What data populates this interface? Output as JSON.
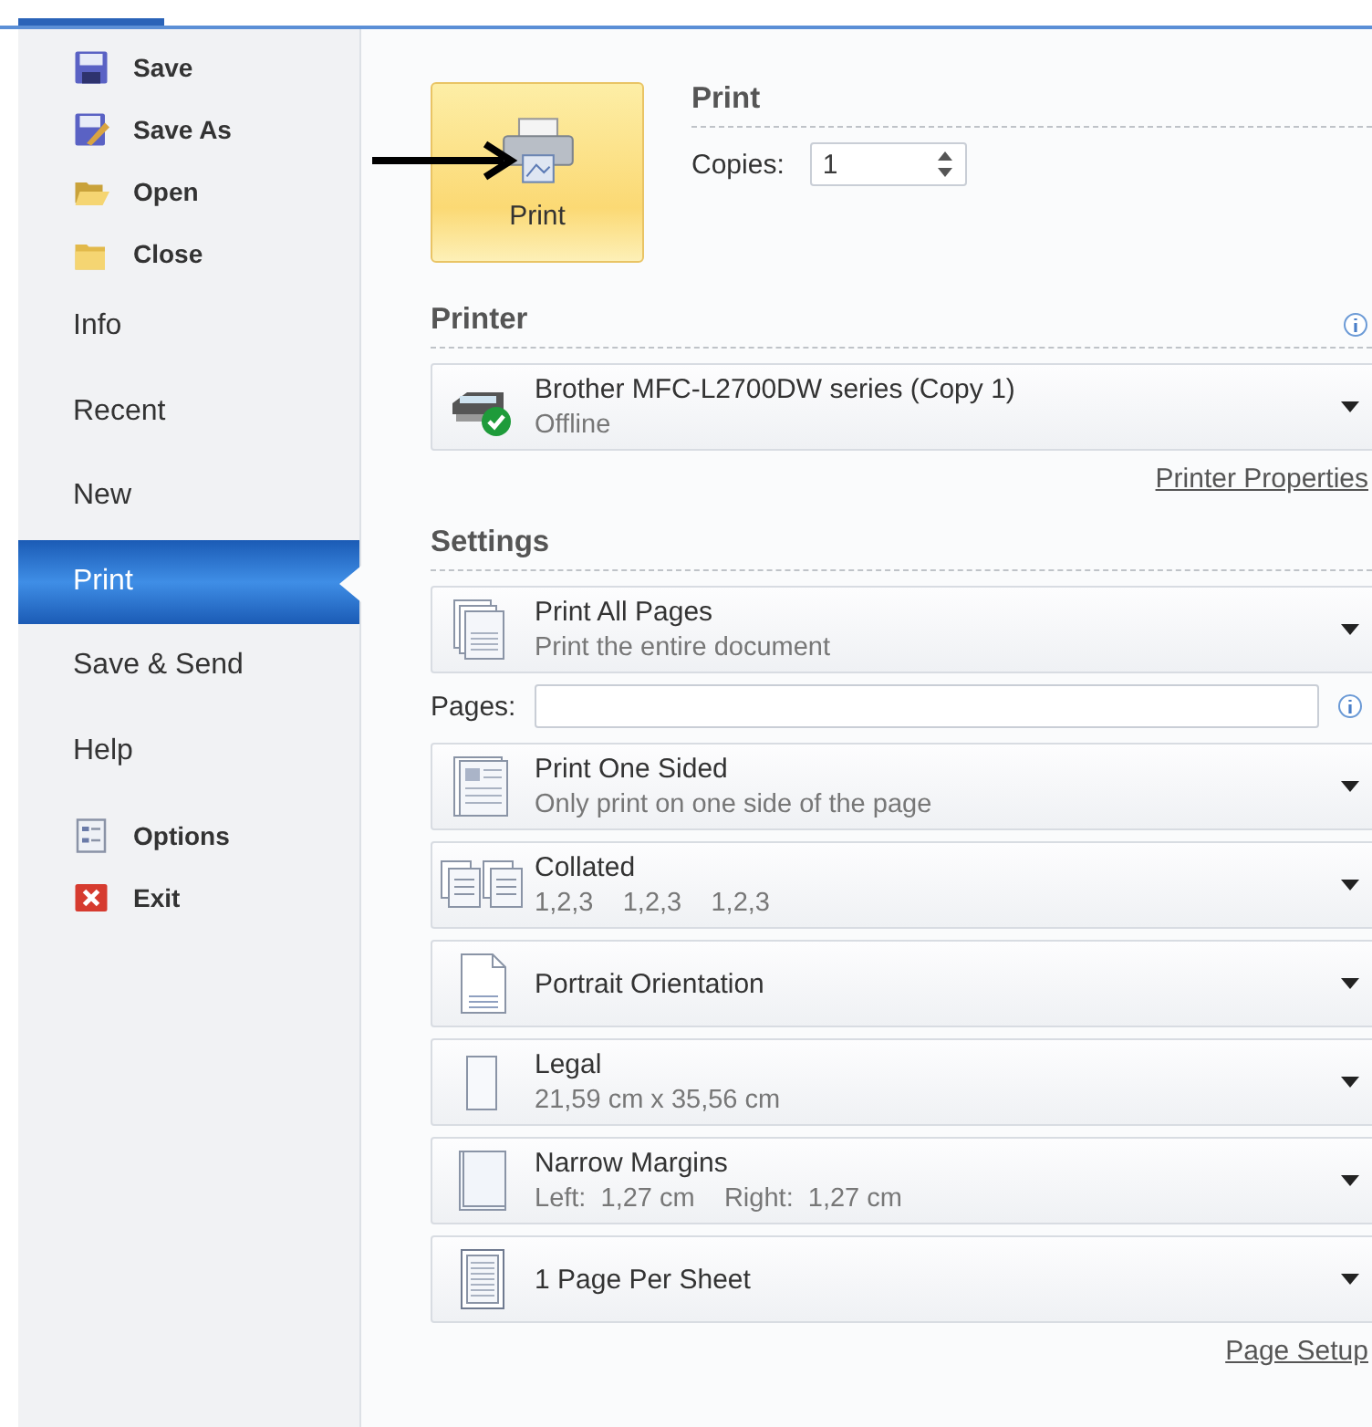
{
  "sidebar": {
    "items": [
      {
        "kind": "save",
        "label": "Save",
        "selected": false
      },
      {
        "kind": "save-as",
        "label": "Save As",
        "selected": false
      },
      {
        "kind": "open",
        "label": "Open",
        "selected": false
      },
      {
        "kind": "close",
        "label": "Close",
        "selected": false
      },
      {
        "kind": "tab",
        "label": "Info",
        "selected": false
      },
      {
        "kind": "tab",
        "label": "Recent",
        "selected": false
      },
      {
        "kind": "tab",
        "label": "New",
        "selected": false
      },
      {
        "kind": "tab",
        "label": "Print",
        "selected": true
      },
      {
        "kind": "tab",
        "label": "Save & Send",
        "selected": false
      },
      {
        "kind": "tab",
        "label": "Help",
        "selected": false
      },
      {
        "kind": "options",
        "label": "Options",
        "selected": false
      },
      {
        "kind": "exit",
        "label": "Exit",
        "selected": false
      }
    ]
  },
  "print": {
    "button": "Print",
    "heading": "Print",
    "copies_label": "Copies:",
    "copies_value": "1"
  },
  "printer": {
    "heading": "Printer",
    "name": "Brother MFC-L2700DW series (Copy 1)",
    "status": "Offline",
    "link": "Printer Properties"
  },
  "settings": {
    "heading": "Settings",
    "items": [
      {
        "kind": "all-pages",
        "title": "Print All Pages",
        "subtitle": "Print the entire document"
      },
      {
        "kind": "pages",
        "label": "Pages:"
      },
      {
        "kind": "one-sided",
        "title": "Print One Sided",
        "subtitle": "Only print on one side of the page"
      },
      {
        "kind": "collated",
        "title": "Collated",
        "subtitle": "1,2,3    1,2,3    1,2,3"
      },
      {
        "kind": "portrait",
        "title": "Portrait Orientation"
      },
      {
        "kind": "paper",
        "title": "Legal",
        "subtitle": "21,59 cm x 35,56 cm"
      },
      {
        "kind": "margins",
        "title": "Narrow Margins",
        "subtitle": "Left:  1,27 cm    Right:  1,27 cm"
      },
      {
        "kind": "per-sheet",
        "title": "1 Page Per Sheet"
      }
    ],
    "link": "Page Setup"
  }
}
